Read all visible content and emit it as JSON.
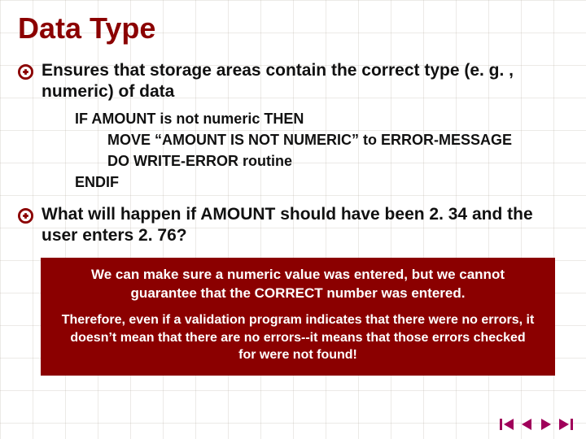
{
  "title": "Data Type",
  "bullets": [
    {
      "text": "Ensures that storage areas contain the correct type (e. g. , numeric) of data"
    },
    {
      "text": "What will happen if AMOUNT should have been 2. 34 and the user enters 2. 76?"
    }
  ],
  "code": {
    "lines": [
      "IF AMOUNT is not numeric THEN",
      "        MOVE “AMOUNT IS NOT NUMERIC” to ERROR-MESSAGE",
      "        DO WRITE-ERROR routine",
      "ENDIF"
    ]
  },
  "callout": {
    "p1": "We can make sure a numeric value was entered, but we cannot guarantee that the CORRECT number was entered.",
    "p2": "Therefore, even if a validation program indicates that there were no errors, it doesn’t mean that there are no errors--it means that those errors checked for were not found!"
  },
  "nav": {
    "first": "first-slide",
    "prev": "previous-slide",
    "next": "next-slide",
    "last": "last-slide"
  }
}
